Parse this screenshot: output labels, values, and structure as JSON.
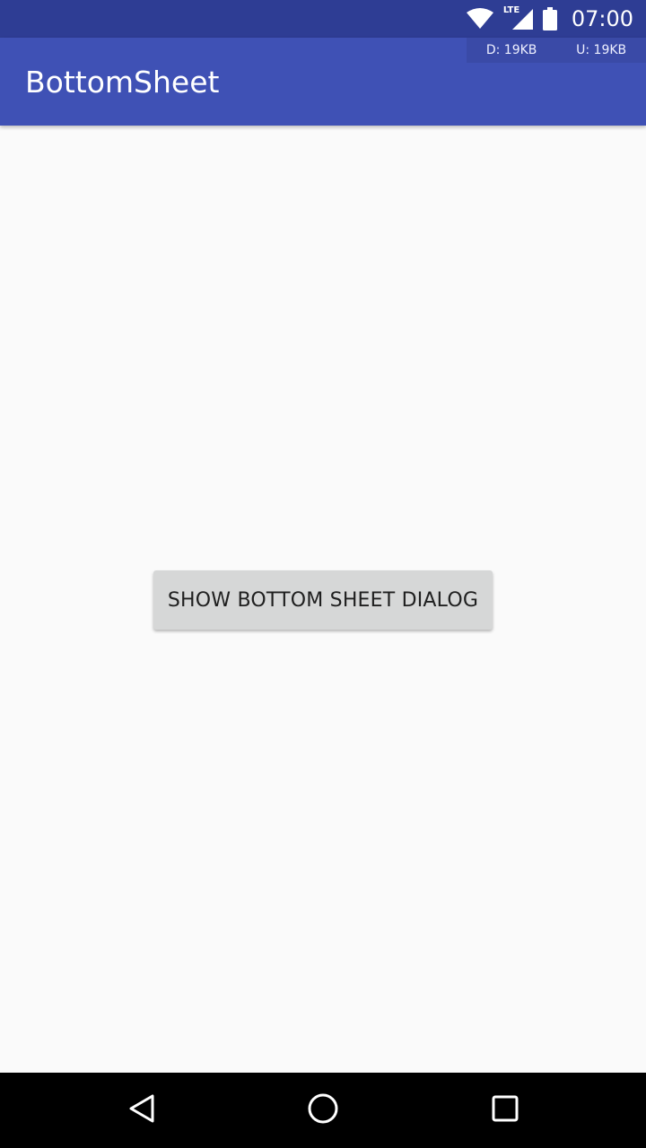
{
  "status_bar": {
    "time": "07:00",
    "network_label": "LTE",
    "icons": [
      "wifi-icon",
      "cell-signal-icon",
      "battery-icon"
    ]
  },
  "app_bar": {
    "title": "BottomSheet",
    "net_meter": {
      "download": "D: 19KB",
      "upload": "U: 19KB"
    }
  },
  "main": {
    "show_button_label": "SHOW BOTTOM SHEET DIALOG"
  },
  "nav_bar": {
    "icons": [
      "back-icon",
      "home-icon",
      "recents-icon"
    ]
  },
  "colors": {
    "status_bar": "#2e3d94",
    "app_bar": "#3f51b5",
    "background": "#fafafa",
    "button": "#d6d7d7",
    "nav_bar": "#000000"
  }
}
